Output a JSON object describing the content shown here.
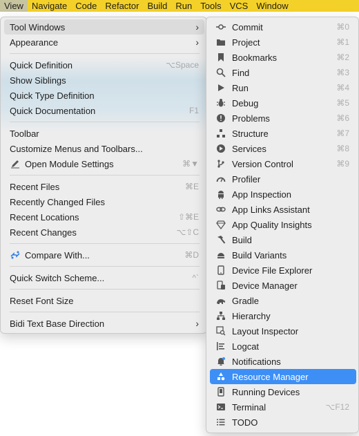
{
  "menubar": {
    "items": [
      "View",
      "Navigate",
      "Code",
      "Refactor",
      "Build",
      "Run",
      "Tools",
      "VCS",
      "Window"
    ]
  },
  "view_menu": {
    "items": [
      {
        "label": "Tool Windows",
        "shortcut": "",
        "submenu": true
      },
      {
        "label": "Appearance",
        "shortcut": "",
        "submenu": true
      },
      {
        "label": "Quick Definition",
        "shortcut": "⌥Space"
      },
      {
        "label": "Show Siblings",
        "shortcut": ""
      },
      {
        "label": "Quick Type Definition",
        "shortcut": ""
      },
      {
        "label": "Quick Documentation",
        "shortcut": "F1"
      },
      {
        "label": "Toolbar",
        "shortcut": ""
      },
      {
        "label": "Customize Menus and Toolbars...",
        "shortcut": ""
      },
      {
        "label": "Open Module Settings",
        "shortcut": "⌘▼",
        "icon": "edit-icon"
      },
      {
        "label": "Recent Files",
        "shortcut": "⌘E"
      },
      {
        "label": "Recently Changed Files",
        "shortcut": ""
      },
      {
        "label": "Recent Locations",
        "shortcut": "⇧⌘E"
      },
      {
        "label": "Recent Changes",
        "shortcut": "⌥⇧C"
      },
      {
        "label": "Compare With...",
        "shortcut": "⌘D",
        "icon": "compare-icon"
      },
      {
        "label": "Quick Switch Scheme...",
        "shortcut": "^`"
      },
      {
        "label": "Reset Font Size",
        "shortcut": ""
      },
      {
        "label": "Bidi Text Base Direction",
        "shortcut": "",
        "submenu": true
      }
    ]
  },
  "tool_windows": {
    "items": [
      {
        "label": "Commit",
        "shortcut": "⌘0",
        "icon": "commit-icon"
      },
      {
        "label": "Project",
        "shortcut": "⌘1",
        "icon": "folder-icon"
      },
      {
        "label": "Bookmarks",
        "shortcut": "⌘2",
        "icon": "bookmark-icon"
      },
      {
        "label": "Find",
        "shortcut": "⌘3",
        "icon": "search-icon"
      },
      {
        "label": "Run",
        "shortcut": "⌘4",
        "icon": "play-icon"
      },
      {
        "label": "Debug",
        "shortcut": "⌘5",
        "icon": "bug-icon"
      },
      {
        "label": "Problems",
        "shortcut": "⌘6",
        "icon": "warning-icon"
      },
      {
        "label": "Structure",
        "shortcut": "⌘7",
        "icon": "structure-icon"
      },
      {
        "label": "Services",
        "shortcut": "⌘8",
        "icon": "services-icon"
      },
      {
        "label": "Version Control",
        "shortcut": "⌘9",
        "icon": "branch-icon"
      },
      {
        "label": "Profiler",
        "shortcut": "",
        "icon": "gauge-icon"
      },
      {
        "label": "App Inspection",
        "shortcut": "",
        "icon": "android-icon"
      },
      {
        "label": "App Links Assistant",
        "shortcut": "",
        "icon": "link-icon"
      },
      {
        "label": "App Quality Insights",
        "shortcut": "",
        "icon": "diamond-icon"
      },
      {
        "label": "Build",
        "shortcut": "",
        "icon": "hammer-icon"
      },
      {
        "label": "Build Variants",
        "shortcut": "",
        "icon": "build-variants-icon"
      },
      {
        "label": "Device File Explorer",
        "shortcut": "",
        "icon": "phone-icon"
      },
      {
        "label": "Device Manager",
        "shortcut": "",
        "icon": "device-manager-icon"
      },
      {
        "label": "Gradle",
        "shortcut": "",
        "icon": "gradle-icon"
      },
      {
        "label": "Hierarchy",
        "shortcut": "",
        "icon": "hierarchy-icon"
      },
      {
        "label": "Layout Inspector",
        "shortcut": "",
        "icon": "layout-inspector-icon"
      },
      {
        "label": "Logcat",
        "shortcut": "",
        "icon": "logcat-icon"
      },
      {
        "label": "Notifications",
        "shortcut": "",
        "icon": "bell-icon"
      },
      {
        "label": "Resource Manager",
        "shortcut": "",
        "icon": "resource-icon",
        "selected": true
      },
      {
        "label": "Running Devices",
        "shortcut": "",
        "icon": "device-icon"
      },
      {
        "label": "Terminal",
        "shortcut": "⌥F12",
        "icon": "terminal-icon"
      },
      {
        "label": "TODO",
        "shortcut": "",
        "icon": "list-icon"
      }
    ]
  },
  "colors": {
    "menubar_bg": "#f4d128",
    "selection": "#3d8ff6"
  }
}
